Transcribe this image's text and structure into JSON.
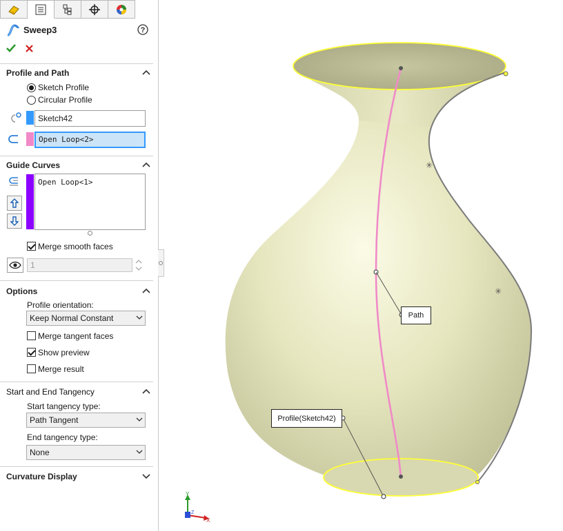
{
  "feature": {
    "title": "Sweep3"
  },
  "sections": {
    "profile_path": {
      "title": "Profile and Path",
      "sketch_profile": "Sketch Profile",
      "circular_profile": "Circular Profile",
      "profile_value": "Sketch42",
      "path_value": "Open Loop<2>"
    },
    "guide_curves": {
      "title": "Guide Curves",
      "list_item": "Open Loop<1>",
      "merge_smooth": "Merge smooth faces",
      "count_value": "1"
    },
    "options": {
      "title": "Options",
      "orientation_label": "Profile orientation:",
      "orientation_value": "Keep Normal Constant",
      "merge_tangent": "Merge tangent faces",
      "show_preview": "Show preview",
      "merge_result": "Merge result"
    },
    "tangency": {
      "title": "Start and End Tangency",
      "start_label": "Start tangency type:",
      "start_value": "Path Tangent",
      "end_label": "End tangency type:",
      "end_value": "None"
    },
    "curvature": {
      "title": "Curvature Display"
    }
  },
  "viewport": {
    "callout_path": "Path",
    "callout_profile": "Profile(Sketch42)",
    "triad": {
      "y": "Y",
      "x": "X",
      "z": "Z"
    }
  },
  "state": {
    "sketch_profile_selected": true,
    "merge_smooth_checked": true,
    "merge_tangent_checked": false,
    "show_preview_checked": true,
    "merge_result_checked": false
  },
  "colors": {
    "accent_blue": "#3399ff",
    "path_pink": "#f08ac8",
    "guide_purple": "#8b00ff",
    "body_fill": "#e6e6bf",
    "edge_yellow": "#ffff33"
  }
}
